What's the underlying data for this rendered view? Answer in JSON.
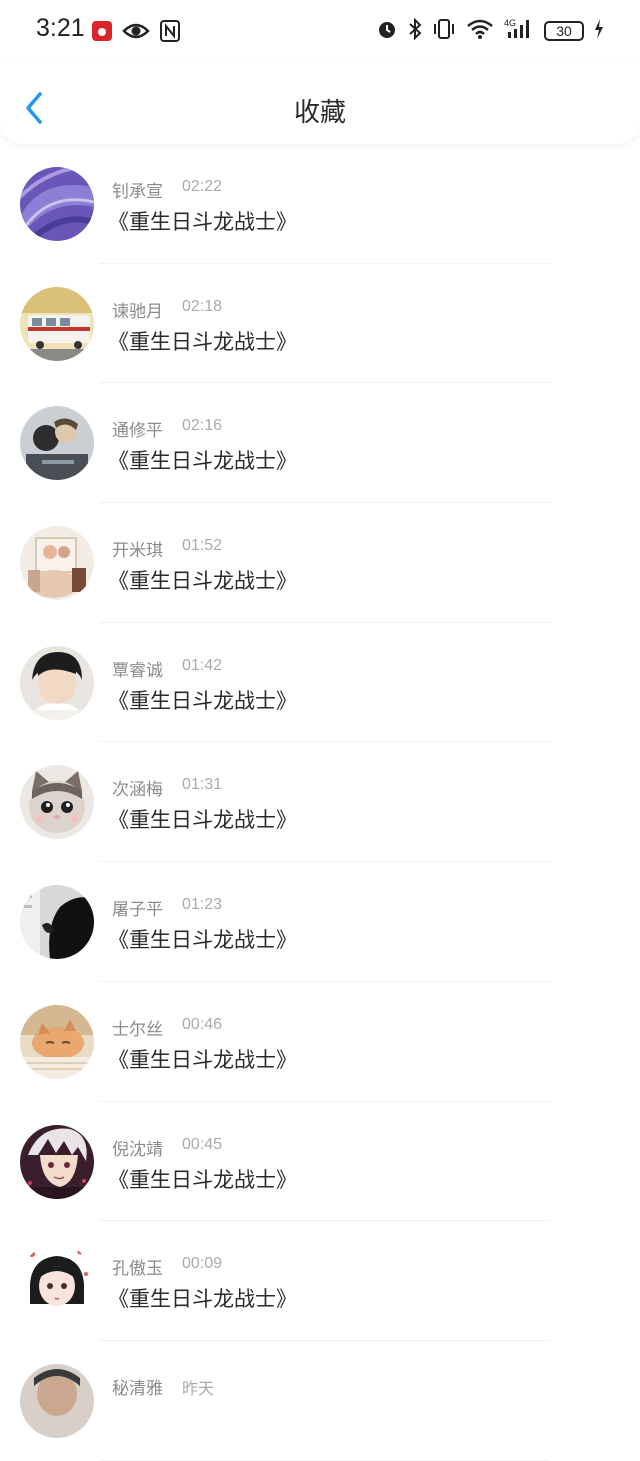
{
  "status_bar": {
    "time": "3:21",
    "battery": "30",
    "signal_label": "4G",
    "icons": [
      "huawei-app-icon",
      "eye-icon",
      "nfc-icon",
      "alarm-icon",
      "bluetooth-icon",
      "vibrate-icon",
      "wifi-icon",
      "signal-icon",
      "battery-icon",
      "charging-icon"
    ]
  },
  "header": {
    "title": "收藏",
    "back_icon": "chevron-left-icon",
    "accent_color": "#2196F3"
  },
  "items": [
    {
      "name": "钊承宣",
      "time": "02:22",
      "title": "《重生日斗龙战士》",
      "avatar": "avatar-feathers"
    },
    {
      "name": "谏驰月",
      "time": "02:18",
      "title": "《重生日斗龙战士》",
      "avatar": "avatar-bus"
    },
    {
      "name": "通修平",
      "time": "02:16",
      "title": "《重生日斗龙战士》",
      "avatar": "avatar-couple"
    },
    {
      "name": "开米琪",
      "time": "01:52",
      "title": "《重生日斗龙战士》",
      "avatar": "avatar-photo"
    },
    {
      "name": "覃睿诚",
      "time": "01:42",
      "title": "《重生日斗龙战士》",
      "avatar": "avatar-boy"
    },
    {
      "name": "次涵梅",
      "time": "01:31",
      "title": "《重生日斗龙战士》",
      "avatar": "avatar-cat"
    },
    {
      "name": "屠子平",
      "time": "01:23",
      "title": "《重生日斗龙战士》",
      "avatar": "avatar-silhouette"
    },
    {
      "name": "士尔丝",
      "time": "00:46",
      "title": "《重生日斗龙战士》",
      "avatar": "avatar-sleeping-cat"
    },
    {
      "name": "倪沈靖",
      "time": "00:45",
      "title": "《重生日斗龙战士》",
      "avatar": "avatar-anime-boy"
    },
    {
      "name": "孔傲玉",
      "time": "00:09",
      "title": "《重生日斗龙战士》",
      "avatar": "avatar-anime-girl"
    },
    {
      "name": "秘清雅",
      "time": "昨天",
      "title": "",
      "avatar": "avatar-partial"
    }
  ]
}
